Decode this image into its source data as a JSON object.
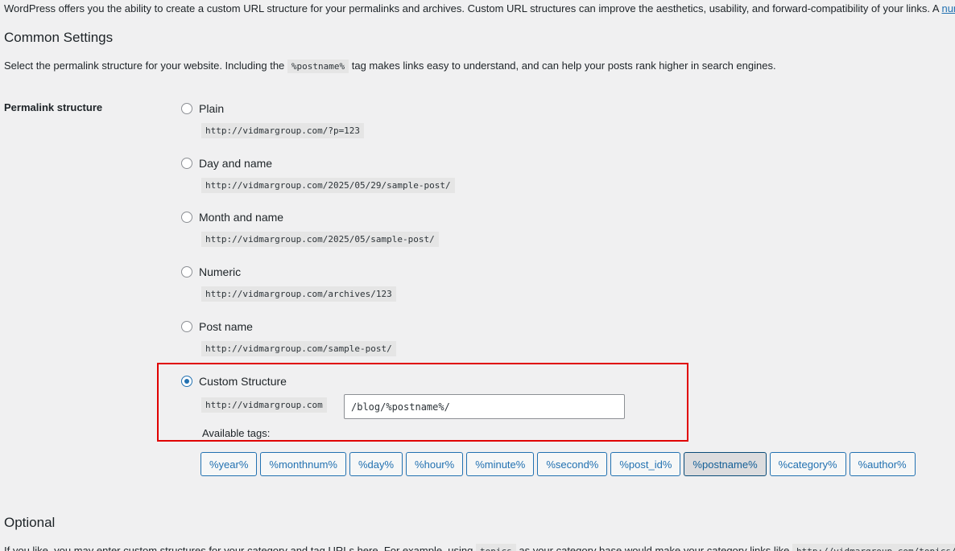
{
  "intro": {
    "text": "WordPress offers you the ability to create a custom URL structure for your permalinks and archives. Custom URL structures can improve the aesthetics, usability, and forward-compatibility of your links. A ",
    "link": "num"
  },
  "common": {
    "title": "Common Settings",
    "desc_before": "Select the permalink structure for your website. Including the ",
    "desc_code": "%postname%",
    "desc_after": " tag makes links easy to understand, and can help your posts rank higher in search engines."
  },
  "permalink": {
    "label": "Permalink structure",
    "options": [
      {
        "label": "Plain",
        "sample": "http://vidmargroup.com/?p=123",
        "checked": false
      },
      {
        "label": "Day and name",
        "sample": "http://vidmargroup.com/2025/05/29/sample-post/",
        "checked": false
      },
      {
        "label": "Month and name",
        "sample": "http://vidmargroup.com/2025/05/sample-post/",
        "checked": false
      },
      {
        "label": "Numeric",
        "sample": "http://vidmargroup.com/archives/123",
        "checked": false
      },
      {
        "label": "Post name",
        "sample": "http://vidmargroup.com/sample-post/",
        "checked": false
      },
      {
        "label": "Custom Structure",
        "checked": true
      }
    ],
    "custom_base": "http://vidmargroup.com",
    "custom_value": "/blog/%postname%/",
    "available_tags_label": "Available tags:",
    "tags": [
      "%year%",
      "%monthnum%",
      "%day%",
      "%hour%",
      "%minute%",
      "%second%",
      "%post_id%",
      "%postname%",
      "%category%",
      "%author%"
    ],
    "active_tag": "%postname%"
  },
  "optional": {
    "title": "Optional",
    "desc_before": "If you like, you may enter custom structures for your category and tag URLs here. For example, using ",
    "desc_code": "topics",
    "desc_after": " as your category base would make your category links like ",
    "desc_code2": "http://vidmargroup.com/topics/"
  },
  "colors": {
    "accent": "#2271b1",
    "highlight_border": "#e00000",
    "background": "#f0f0f1"
  }
}
